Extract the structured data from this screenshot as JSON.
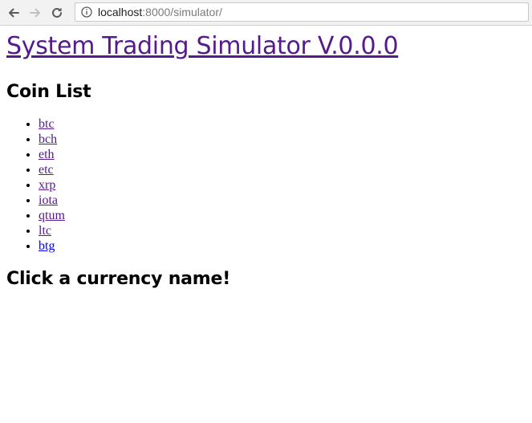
{
  "browser": {
    "url_host": "localhost",
    "url_rest": ":8000/simulator/"
  },
  "page": {
    "title": "System Trading Simulator V.0.0.0",
    "coin_list_heading": "Coin List",
    "coins": [
      "btc",
      "bch",
      "eth",
      "etc",
      "xrp",
      "iota",
      "qtum",
      "ltc",
      "btg"
    ],
    "prompt": "Click a currency name!"
  },
  "colors": {
    "visited_link": "#551a8b",
    "link": "#0000ee"
  }
}
